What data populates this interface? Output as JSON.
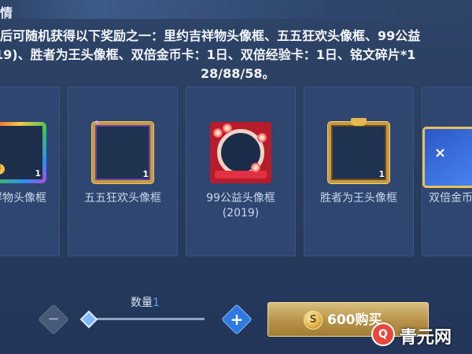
{
  "header": {
    "title": "情"
  },
  "description": {
    "line1": "后可随机获得以下奖励之一：里约吉祥物头像框、五五狂欢头像框、99公益",
    "line2": "19)、胜者为王头像框、双倍金币卡：1日、双倍经验卡：1日、铭文碎片*1",
    "line3": "28/88/58。"
  },
  "rewards": [
    {
      "label": "祥物头像框",
      "count": "1",
      "icon": "rainbow-frame-icon"
    },
    {
      "label": "五五狂欢头像框",
      "count": "1",
      "icon": "gold-frame-icon"
    },
    {
      "label": "99公益头像框(2019)",
      "count": "",
      "icon": "red-flower-frame-icon"
    },
    {
      "label": "胜者为王头像框",
      "count": "1",
      "icon": "king-frame-icon"
    },
    {
      "label": "双倍金币",
      "count": "",
      "icon": "double-coin-card-icon"
    }
  ],
  "quantity": {
    "label": "数量",
    "value": "1",
    "slider_fraction": 0
  },
  "buy": {
    "price": "600",
    "label": "购买",
    "full": "600购买",
    "currency_icon": "coin-icon"
  },
  "watermark": {
    "text": "青元网"
  },
  "colors": {
    "panel": "#2b3f61",
    "accent": "#4aa3ff",
    "buy_gold": "#b89247"
  }
}
